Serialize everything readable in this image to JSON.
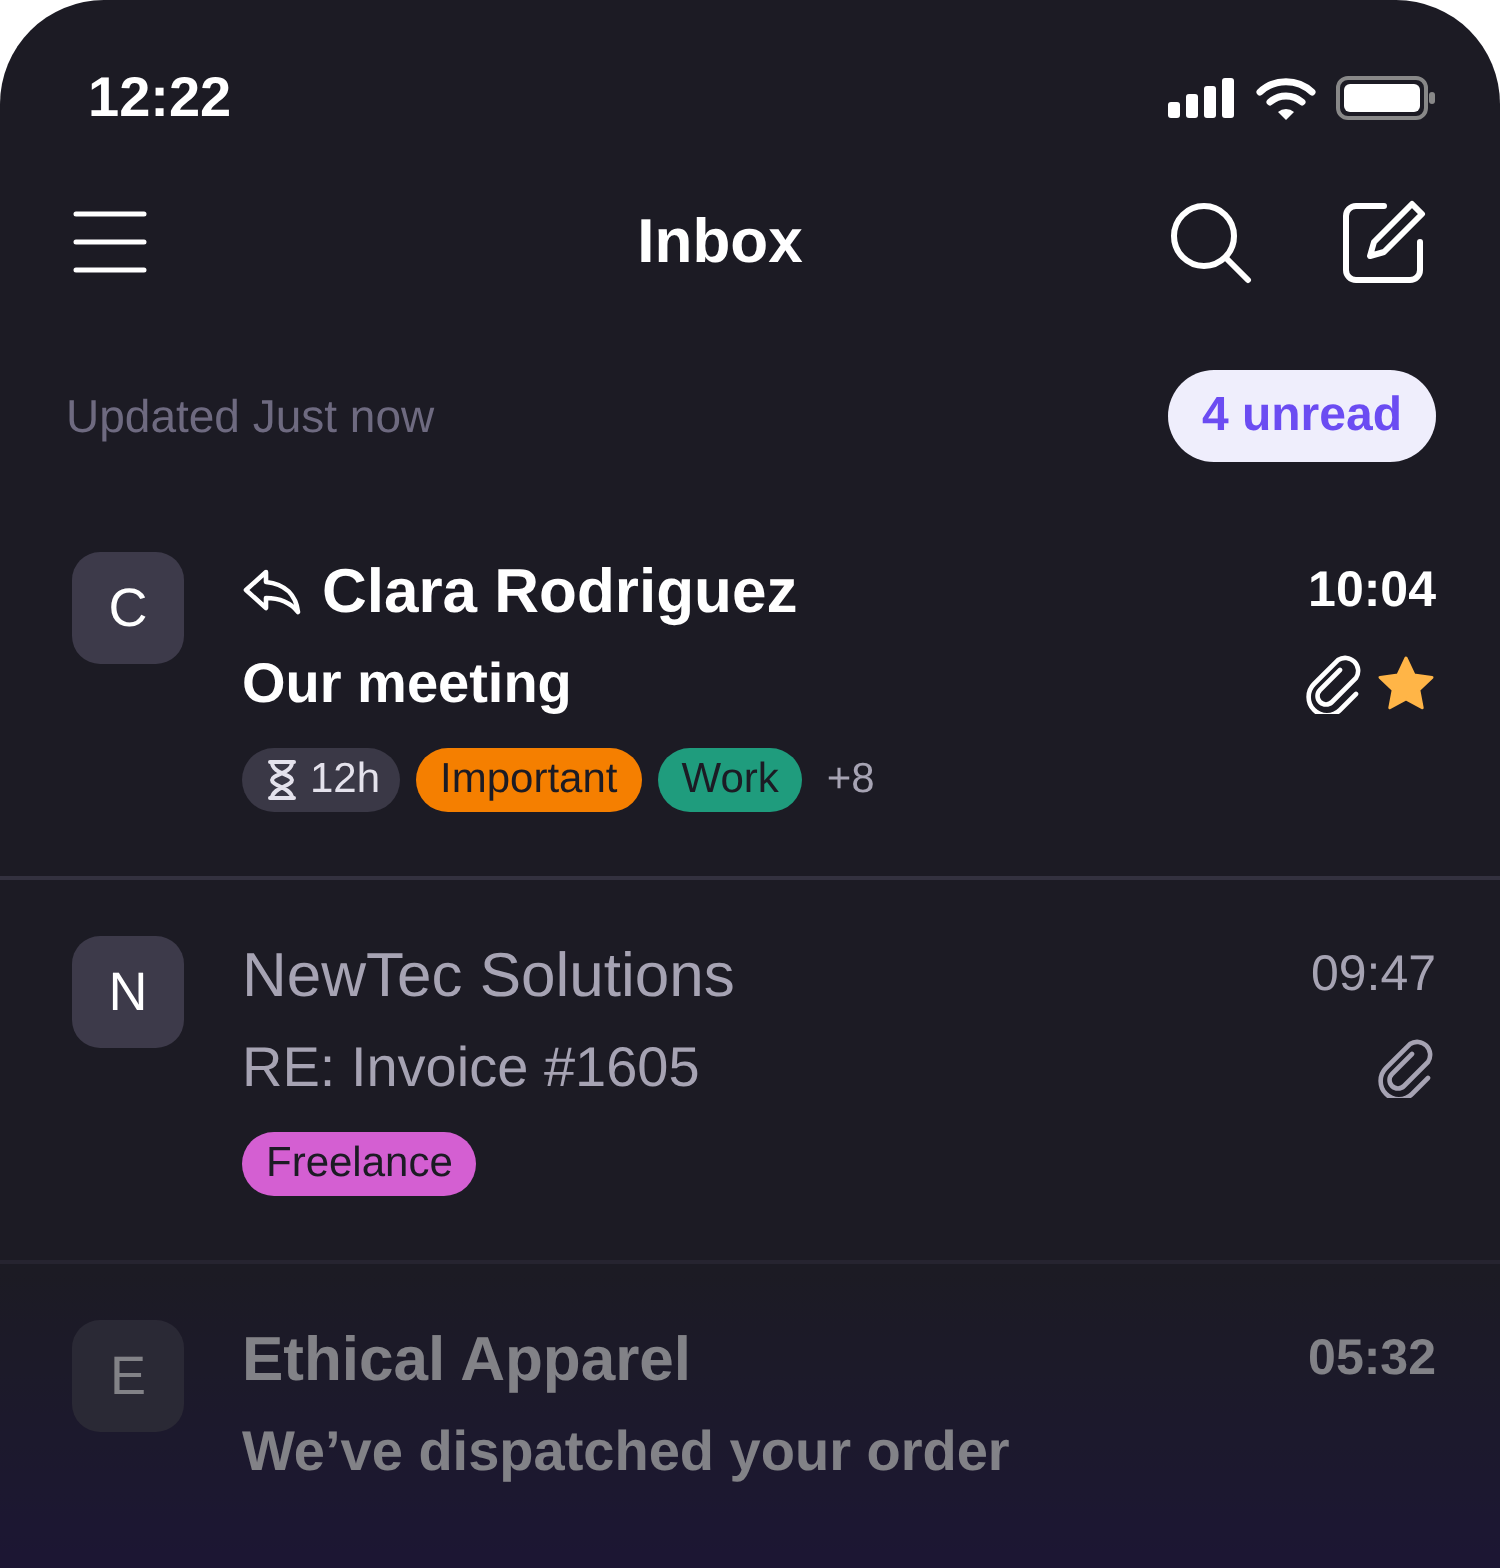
{
  "status_bar": {
    "time": "12:22"
  },
  "header": {
    "title": "Inbox"
  },
  "summary": {
    "updated": "Updated Just now",
    "unread_badge": "4 unread"
  },
  "messages": [
    {
      "initial": "C",
      "sender": "Clara Rodriguez",
      "time": "10:04",
      "subject": "Our meeting",
      "unread": true,
      "replied": true,
      "attachment": true,
      "starred": true,
      "timer": "12h",
      "tags": [
        {
          "label": "Important",
          "color": "#f57f00"
        },
        {
          "label": "Work",
          "color": "#1f9c7d"
        }
      ],
      "more": "+8"
    },
    {
      "initial": "N",
      "sender": "NewTec Solutions",
      "time": "09:47",
      "subject": "RE: Invoice #1605",
      "unread": false,
      "replied": false,
      "attachment": true,
      "starred": false,
      "tags": [
        {
          "label": "Freelance",
          "color": "#d45fd2"
        }
      ]
    },
    {
      "initial": "E",
      "sender": "Ethical Apparel",
      "time": "05:32",
      "subject": "We’ve dispatched your order",
      "unread": true,
      "replied": false,
      "attachment": false,
      "starred": false
    }
  ]
}
